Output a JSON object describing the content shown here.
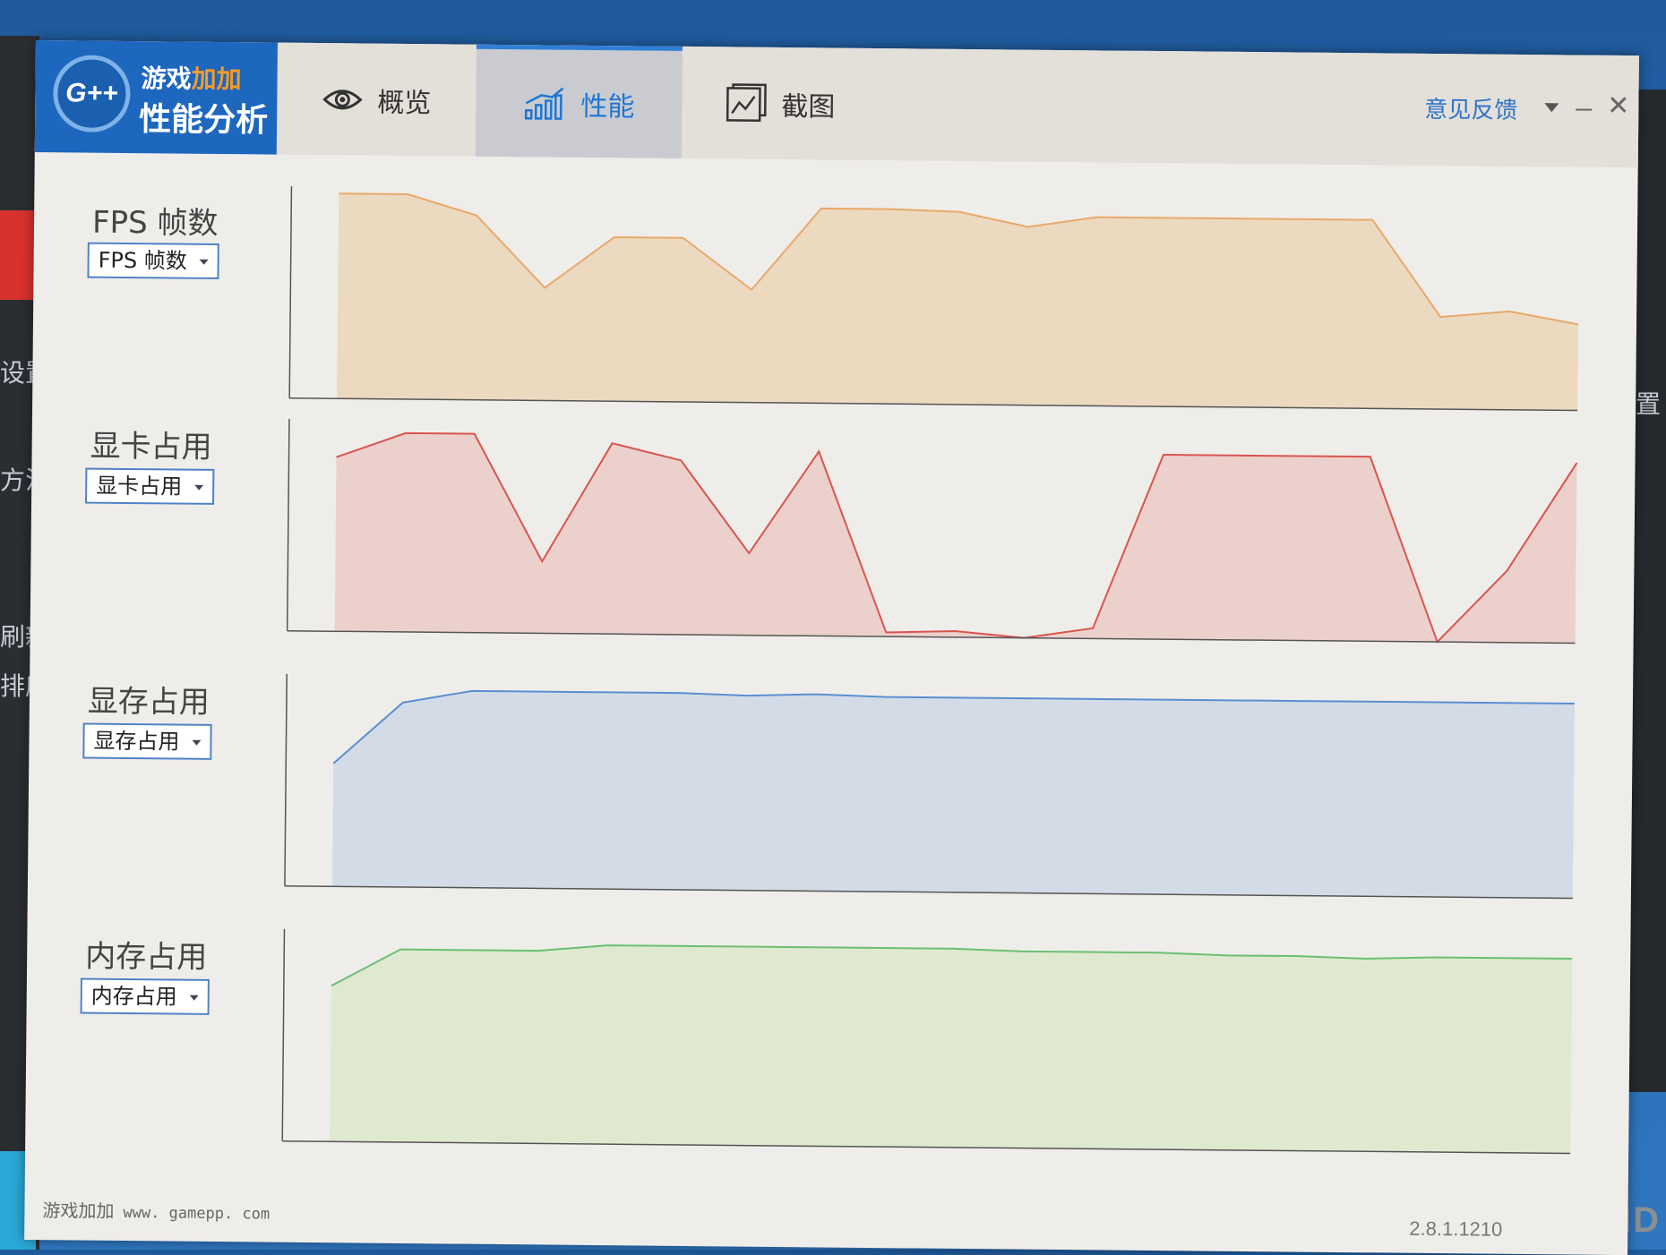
{
  "app": {
    "logo_badge": "G++",
    "logo_line1_a": "游戏",
    "logo_line1_b": "加加",
    "logo_line2": "性能分析"
  },
  "tabs": [
    {
      "label": "概览",
      "icon": "eye-icon",
      "active": false
    },
    {
      "label": "性能",
      "icon": "bar-chart-icon",
      "active": true
    },
    {
      "label": "截图",
      "icon": "picture-icon",
      "active": false
    }
  ],
  "titlebar": {
    "feedback": "意见反馈"
  },
  "metrics": [
    {
      "title": "FPS 帧数",
      "selected": "FPS 帧数"
    },
    {
      "title": "显卡占用",
      "selected": "显卡占用"
    },
    {
      "title": "显存占用",
      "selected": "显存占用"
    },
    {
      "title": "内存占用",
      "selected": "内存占用"
    }
  ],
  "chart_data": [
    {
      "type": "area",
      "color": "#e8a96a",
      "fill": "#ebd9c0",
      "ylim": [
        0,
        100
      ],
      "values": [
        100,
        100,
        90,
        55,
        80,
        80,
        55,
        95,
        95,
        94,
        87,
        92,
        92,
        92,
        92,
        92,
        45,
        48,
        42
      ]
    },
    {
      "type": "area",
      "color": "#d9544f",
      "fill": "#ecd0cc",
      "ylim": [
        0,
        100
      ],
      "values": [
        85,
        97,
        97,
        35,
        93,
        85,
        40,
        90,
        2,
        3,
        0,
        5,
        90,
        90,
        90,
        90,
        0,
        35,
        88
      ]
    },
    {
      "type": "area",
      "color": "#5a8fd0",
      "fill": "#d3dce6",
      "ylim": [
        0,
        100
      ],
      "values": [
        60,
        90,
        96,
        96,
        96,
        96,
        95,
        96,
        95,
        95,
        95,
        95,
        95,
        95,
        95,
        95,
        95,
        95,
        95
      ]
    },
    {
      "type": "area",
      "color": "#6bbf72",
      "fill": "#dfe9cf",
      "ylim": [
        0,
        100
      ],
      "values": [
        76,
        94,
        94,
        94,
        97,
        97,
        97,
        97,
        97,
        97,
        96,
        96,
        96,
        95,
        95,
        94,
        95,
        95,
        95
      ]
    }
  ],
  "footer": {
    "brand": "游戏加加",
    "url": "www. gamepp. com",
    "version": "2.8.1.1210"
  },
  "desktop": {
    "left_labels": [
      "设置",
      "方法",
      "刷新",
      "排序"
    ],
    "right_label": "置",
    "brand": "AMD"
  }
}
